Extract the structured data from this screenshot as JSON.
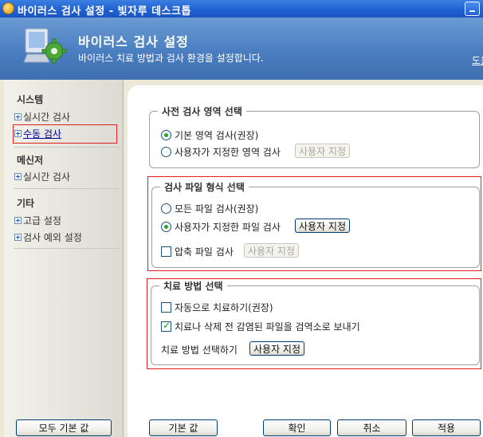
{
  "window": {
    "title": "바이러스 검사 설정 - 빛자루 데스크톱"
  },
  "header": {
    "title": "바이러스 검사 설정",
    "subtitle": "바이러스 치료 방법과 검사 환경을 설정합니다.",
    "help_link": "도움말"
  },
  "sidebar": {
    "groups": [
      {
        "title": "시스템",
        "items": [
          {
            "label": "실시간 검사",
            "active": false
          },
          {
            "label": "수동 검사",
            "active": true
          }
        ]
      },
      {
        "title": "메신저",
        "items": [
          {
            "label": "실시간 검사",
            "active": false
          }
        ]
      },
      {
        "title": "기타",
        "items": [
          {
            "label": "고급 설정",
            "active": false
          },
          {
            "label": "검사 예외 설정",
            "active": false
          }
        ]
      }
    ],
    "reset_all_label": "모두 기본 값"
  },
  "scan_area": {
    "title": "사전 검사 영역 선택",
    "option_default": "기본 영역 검사(권장)",
    "option_custom": "사용자가 지정한 영역 검사",
    "custom_button": "사용자 지정",
    "selected": "default"
  },
  "file_type": {
    "title": "검사 파일 형식 선택",
    "option_all": "모든 파일 검사(권장)",
    "option_custom": "사용자가 지정한 파일 검사",
    "custom_button": "사용자 지정",
    "compressed_label": "압축 파일 검사",
    "compressed_button": "사용자 지정",
    "selected": "custom",
    "compressed_checked": false
  },
  "treatment": {
    "title": "치료 방법 선택",
    "auto_label": "자동으로 치료하기(권장)",
    "auto_checked": false,
    "quarantine_label": "치료나 삭제 전 감염된 파일을 검역소로 보내기",
    "quarantine_checked": true,
    "method_label": "치료 방법 선택하기",
    "custom_button": "사용자 지정"
  },
  "footer": {
    "default_label": "기본 값",
    "ok_label": "확인",
    "cancel_label": "취소",
    "apply_label": "적용"
  },
  "colors": {
    "titlebar": "#1f5fd1",
    "header": "#4a7ec0",
    "highlight": "#e02020",
    "radio_dot": "#2ba52b"
  },
  "icons": {
    "app": "app-icon",
    "header": "monitor-gear-icon",
    "minimize": "minimize-icon"
  }
}
